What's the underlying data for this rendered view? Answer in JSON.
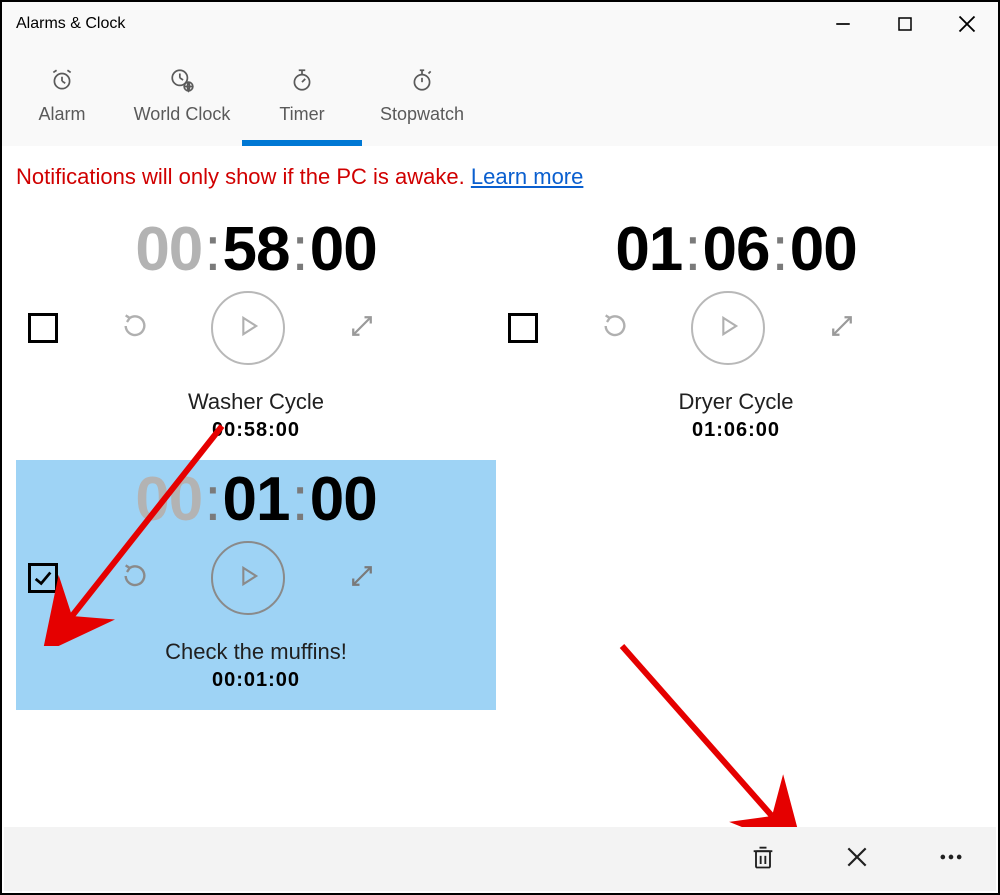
{
  "window": {
    "title": "Alarms & Clock"
  },
  "tabs": [
    {
      "label": "Alarm"
    },
    {
      "label": "World Clock"
    },
    {
      "label": "Timer"
    },
    {
      "label": "Stopwatch"
    }
  ],
  "notification": {
    "text": "Notifications will only show if the PC is awake. ",
    "link": "Learn more"
  },
  "timers": [
    {
      "hours": "00",
      "mins": "58",
      "secs": "00",
      "name": "Washer Cycle",
      "small": "00:58:00",
      "checked": false,
      "selected": false
    },
    {
      "hours": "01",
      "mins": "06",
      "secs": "00",
      "name": "Dryer Cycle",
      "small": "01:06:00",
      "checked": false,
      "selected": false
    },
    {
      "hours": "00",
      "mins": "01",
      "secs": "00",
      "name": "Check the muffins!",
      "small": "00:01:00",
      "checked": true,
      "selected": true
    }
  ]
}
